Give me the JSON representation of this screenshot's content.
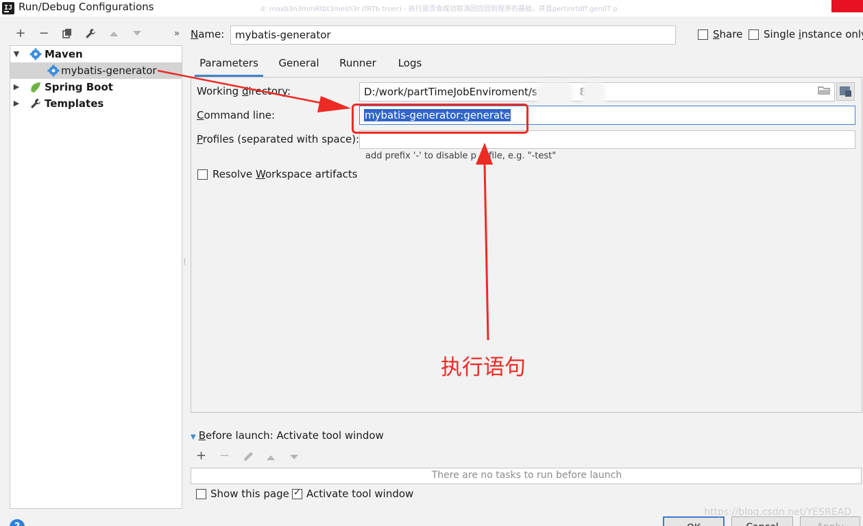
{
  "window": {
    "title": "Run/Debug Configurations",
    "background_ghost_text": "d: maxb3n3m/nRtbt3mesh3r (fRTb truer) - 执行是否会成功取消回应回到程序的基础，并且pertinrtdff.gen0T p"
  },
  "toolbar": {
    "add": "+",
    "remove": "−",
    "expand": "»"
  },
  "tree": {
    "items": [
      {
        "label": "Maven",
        "expanded": true
      },
      {
        "label": "mybatis-generator",
        "selected": true
      },
      {
        "label": "Spring Boot",
        "expanded": false
      },
      {
        "label": "Templates",
        "expanded": false
      }
    ]
  },
  "header": {
    "name_label_pre": "N",
    "name_label_post": "ame:",
    "name_value": "mybatis-generator",
    "share_label_pre": "S",
    "share_label_post": "hare",
    "single_instance_pre": "Single ",
    "single_instance_u": "i",
    "single_instance_post": "nstance only"
  },
  "tabs": [
    {
      "label": "Parameters",
      "active": true
    },
    {
      "label": "General",
      "active": false
    },
    {
      "label": "Runner",
      "active": false
    },
    {
      "label": "Logs",
      "active": false
    }
  ],
  "parameters": {
    "working_dir_label_pre": "Working ",
    "working_dir_label_u": "d",
    "working_dir_label_post": "irectory:",
    "working_dir_value_a": "D:/work/partTimeJobEnviroment/s",
    "working_dir_value_b": "y/",
    "working_dir_value_c": "8",
    "command_line_label_u": "C",
    "command_line_label_post": "ommand line:",
    "command_line_value": "mybatis-generator:generate",
    "profiles_label_u": "P",
    "profiles_label_post": "rofiles (separated with space):",
    "profiles_value": "",
    "profiles_hint_a": "add prefix '-' to disable p",
    "profiles_hint_b": "ofile, e.g. \"-test\"",
    "resolve_label_pre": "Resolve ",
    "resolve_label_u": "W",
    "resolve_label_post": "orkspace artifacts"
  },
  "annotation": {
    "text": "执行语句",
    "color": "#ee2a24"
  },
  "before_launch": {
    "title_pre": "",
    "title_u": "B",
    "title_post": "efore launch: Activate tool window",
    "empty_text": "There are no tasks to run before launch",
    "show_page_label": "Show this page",
    "activate_label": "Activate tool window",
    "activate_checked": true
  },
  "buttons": {
    "ok": "OK",
    "cancel": "Cancel",
    "apply": "Apply"
  },
  "watermark": "https://blog.csdn.net/YESREAD",
  "colors": {
    "accent": "#4083c9",
    "selection": "#2f65ca",
    "close": "#e81123"
  }
}
